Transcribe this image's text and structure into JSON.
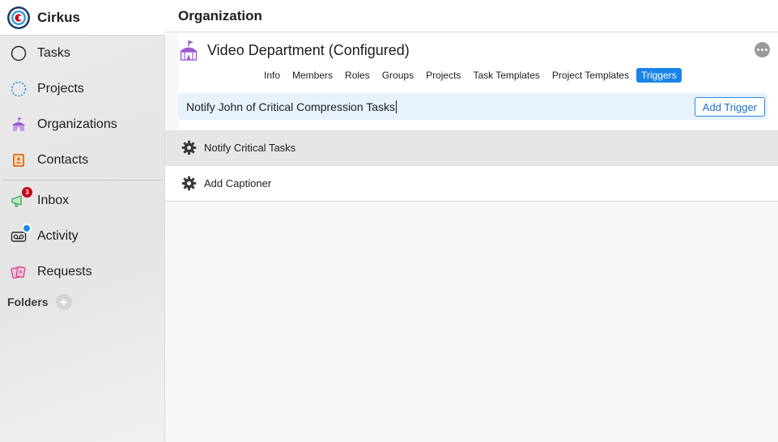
{
  "app": {
    "name": "Cirkus"
  },
  "sidebar": {
    "items": [
      {
        "label": "Tasks",
        "icon": "circle-outline-icon"
      },
      {
        "label": "Projects",
        "icon": "dashed-circle-icon"
      },
      {
        "label": "Organizations",
        "icon": "circus-tent-icon"
      },
      {
        "label": "Contacts",
        "icon": "address-book-icon"
      },
      {
        "label": "Inbox",
        "icon": "megaphone-icon",
        "badge": "3"
      },
      {
        "label": "Activity",
        "icon": "voicemail-icon"
      },
      {
        "label": "Requests",
        "icon": "cards-icon"
      }
    ],
    "folders_label": "Folders",
    "folders_add": "+"
  },
  "main": {
    "title": "Organization",
    "org": {
      "name": "Video Department (Configured)",
      "tabs": [
        "Info",
        "Members",
        "Roles",
        "Groups",
        "Projects",
        "Task Templates",
        "Project Templates",
        "Triggers"
      ],
      "active_tab": "Triggers"
    },
    "trigger_input": {
      "value": "Notify John of Critical Compression Tasks",
      "button_label": "Add Trigger"
    },
    "triggers": [
      {
        "label": "Notify Critical Tasks",
        "selected": true
      },
      {
        "label": "Add Captioner",
        "selected": false
      }
    ]
  },
  "colors": {
    "accent": "#1a84e6",
    "badge_red": "#c4001c",
    "badge_blue": "#1e88e5",
    "brand_red": "#d0021b",
    "brand_navy": "#1b3a6b",
    "tent_purple": "#9b59d0",
    "contacts_orange": "#d9772b",
    "inbox_green": "#3fae55",
    "requests_pink": "#d63c7e"
  }
}
